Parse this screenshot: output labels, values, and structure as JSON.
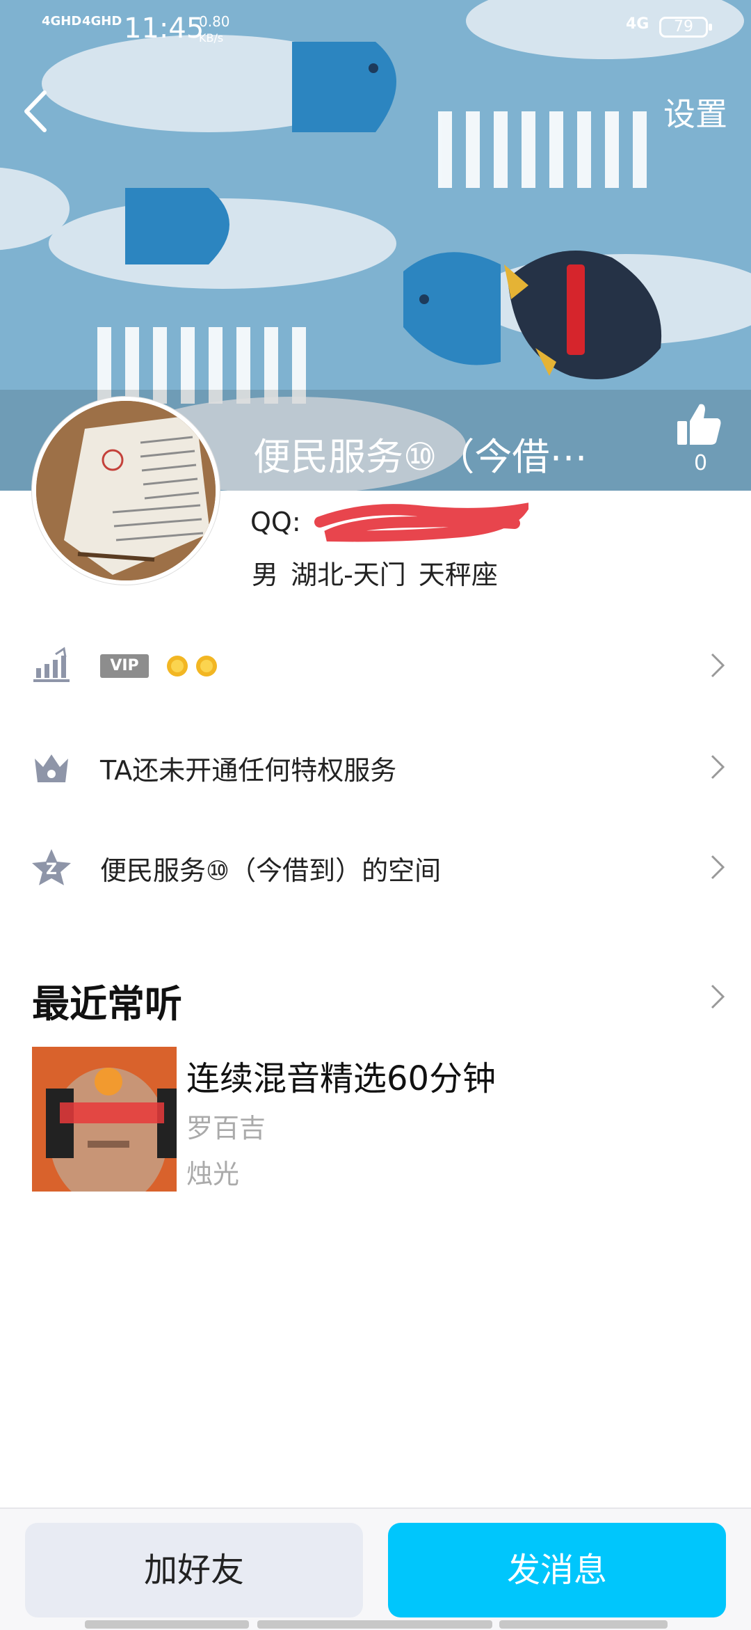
{
  "status_bar": {
    "signal_1": "4GHD",
    "signal_2": "4GHD",
    "time": "11:45",
    "speed_value": "0.80",
    "speed_unit": "KB/s",
    "network": "4G",
    "battery": "79"
  },
  "header": {
    "back_icon": "chevron-left-icon",
    "settings_label": "设置",
    "nickname": "便民服务⑩（今借⋯",
    "like_icon": "thumbs-up-icon",
    "like_count": "0"
  },
  "profile": {
    "qq_label": "QQ:",
    "info": "男  湖北-天门  天秤座"
  },
  "rows": [
    {
      "icon": "level-chart-icon",
      "badge": "VIP",
      "level_icons": [
        "sun-icon",
        "sun-icon"
      ]
    },
    {
      "icon": "crown-icon",
      "label": "TA还未开通任何特权服务"
    },
    {
      "icon": "qzone-star-icon",
      "label": "便民服务⑩（今借到）的空间"
    }
  ],
  "recent_music": {
    "title": "最近常听",
    "song": {
      "title": "连续混音精选60分钟",
      "artist": "罗百吉",
      "album": "烛光"
    }
  },
  "actions": {
    "add_friend": "加好友",
    "send_message": "发消息"
  },
  "colors": {
    "accent": "#00c6fc",
    "banner": "#7fb2d0",
    "redaction": "#e8454d"
  }
}
